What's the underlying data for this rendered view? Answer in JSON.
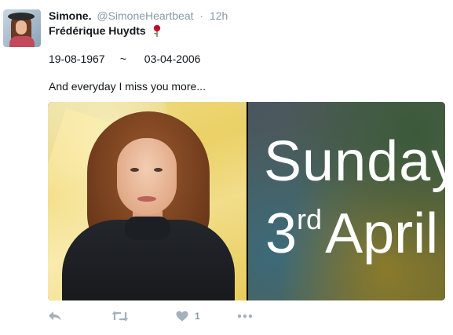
{
  "tweet": {
    "display_name": "Simone.",
    "handle": "@SimoneHeartbeat",
    "separator": "·",
    "timestamp": "12h",
    "line1": "Frédérique Huydts",
    "date_start": "19-08-1967",
    "tilde": "~",
    "date_end": "03-04-2006",
    "message": "And everyday I miss you more...",
    "like_count": "1"
  },
  "media": {
    "right_panel_line1": "Sunday",
    "right_panel_day": "3",
    "right_panel_suffix": "rd",
    "right_panel_month": "April"
  },
  "icons": {
    "rose": "rose-icon",
    "reply": "reply-icon",
    "retweet": "retweet-icon",
    "like": "heart-icon",
    "more": "more-icon"
  },
  "colors": {
    "text": "#14171a",
    "muted": "#8899a6",
    "action": "#a4b0bb",
    "rose": "#c8102e"
  }
}
